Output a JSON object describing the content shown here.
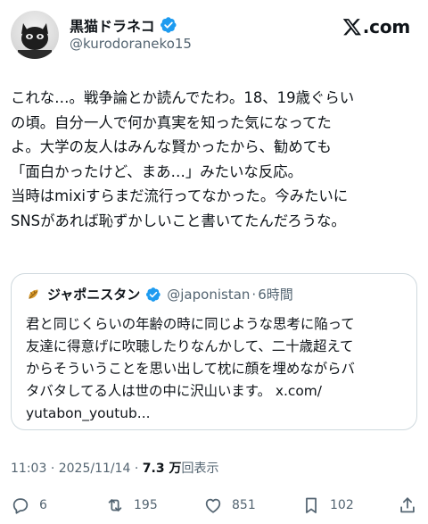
{
  "author": {
    "display_name": "黒猫ドラネコ",
    "handle": "@kurodoraneko15",
    "verified": true
  },
  "platform": {
    "logo_text": ".com",
    "logo_icon": "x-logo-icon"
  },
  "tweet": {
    "lines": [
      "これな…。戦争論とか読んでたわ。18、19歳ぐらい",
      "の頃。自分一人で何か真実を知った気になってた",
      "よ。大学の友人はみんな賢かったから、勧めても",
      "「面白かったけど、まあ…」みたいな反応。",
      "当時はmixiすらまだ流行ってなかった。今みたいに",
      "SNSがあれば恥ずかしいこと書いてたんだろうな。"
    ]
  },
  "quote": {
    "display_name": "ジャポニスタン",
    "handle": "@japonistan",
    "time": "6時間",
    "separator": "·",
    "lines": [
      "君と同じくらいの年齢の時に同じような思考に陥って",
      "友達に得意げに吹聴したりなんかして、二十歳超えて",
      "からそういうことを思い出して枕に顔を埋めながらバ",
      "タバタしてる人は世の中に沢山います。 x.com/",
      "yutabon_youtub..."
    ]
  },
  "meta": {
    "time": "11:03",
    "date": "2025/11/14",
    "separator": "·",
    "views": "7.3 万",
    "views_label": "回表示"
  },
  "actions": {
    "replies": "6",
    "reposts": "195",
    "likes": "851",
    "bookmarks": "102"
  },
  "colors": {
    "text": "#0f1419",
    "secondary": "#536471",
    "verified": "#1d9bf0",
    "border": "#cfd9de"
  }
}
